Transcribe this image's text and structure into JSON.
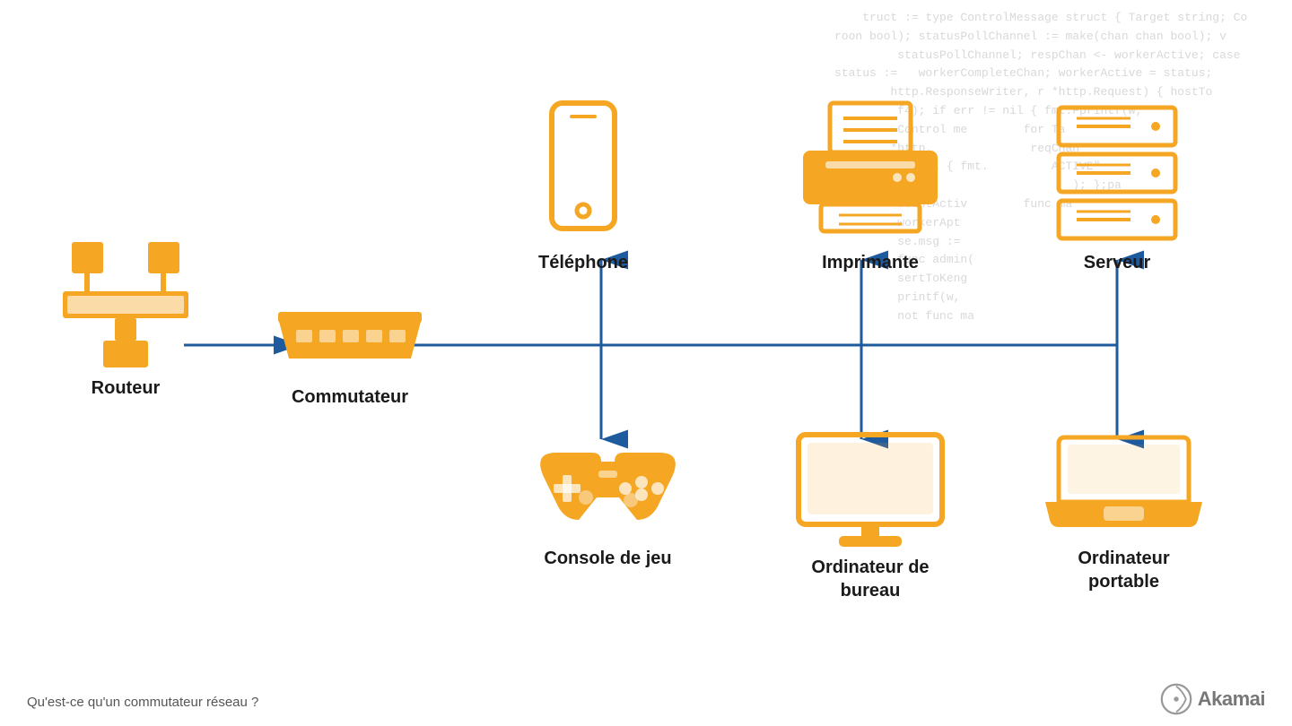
{
  "bg_code": "truct := type ControlMessage struct { Target string; Co\nbool); statusPollChannel := make(chan chan bool); v\n         statusPollChannel; respChan <- workerActive; case\nstatus := workerCompleteChan; workerActive = status;\n        http.ResponseWriter, r *http.Request) { hostTo\n         f4); if err != nil { fmt.Fprintf(w,\n         Control me    for Ta\n        *http.         reqChan\n         result { fmt.     ACTIVE\"\n                              ); };pa\n         CountActiv    func ma\n         workerApt\n         se.msg :=\n         func admin(\n         sertToKeng\n         printf(w,\n         not func ma",
  "devices": {
    "routeur": {
      "label": "Routeur"
    },
    "commutateur": {
      "label": "Commutateur"
    },
    "telephone": {
      "label": "Téléphone"
    },
    "console": {
      "label": "Console de jeu"
    },
    "imprimante": {
      "label": "Imprimante"
    },
    "ordi_bureau": {
      "label": "Ordinateur de\nbureau"
    },
    "serveur": {
      "label": "Serveur"
    },
    "ordi_portable": {
      "label": "Ordinateur\nportable"
    }
  },
  "footer": {
    "question": "Qu'est-ce qu'un commutateur réseau ?",
    "brand": "Akamai"
  },
  "colors": {
    "orange": "#F5A623",
    "blue": "#1E5A9E",
    "text_dark": "#1a1a1a",
    "text_gray": "#555555"
  }
}
